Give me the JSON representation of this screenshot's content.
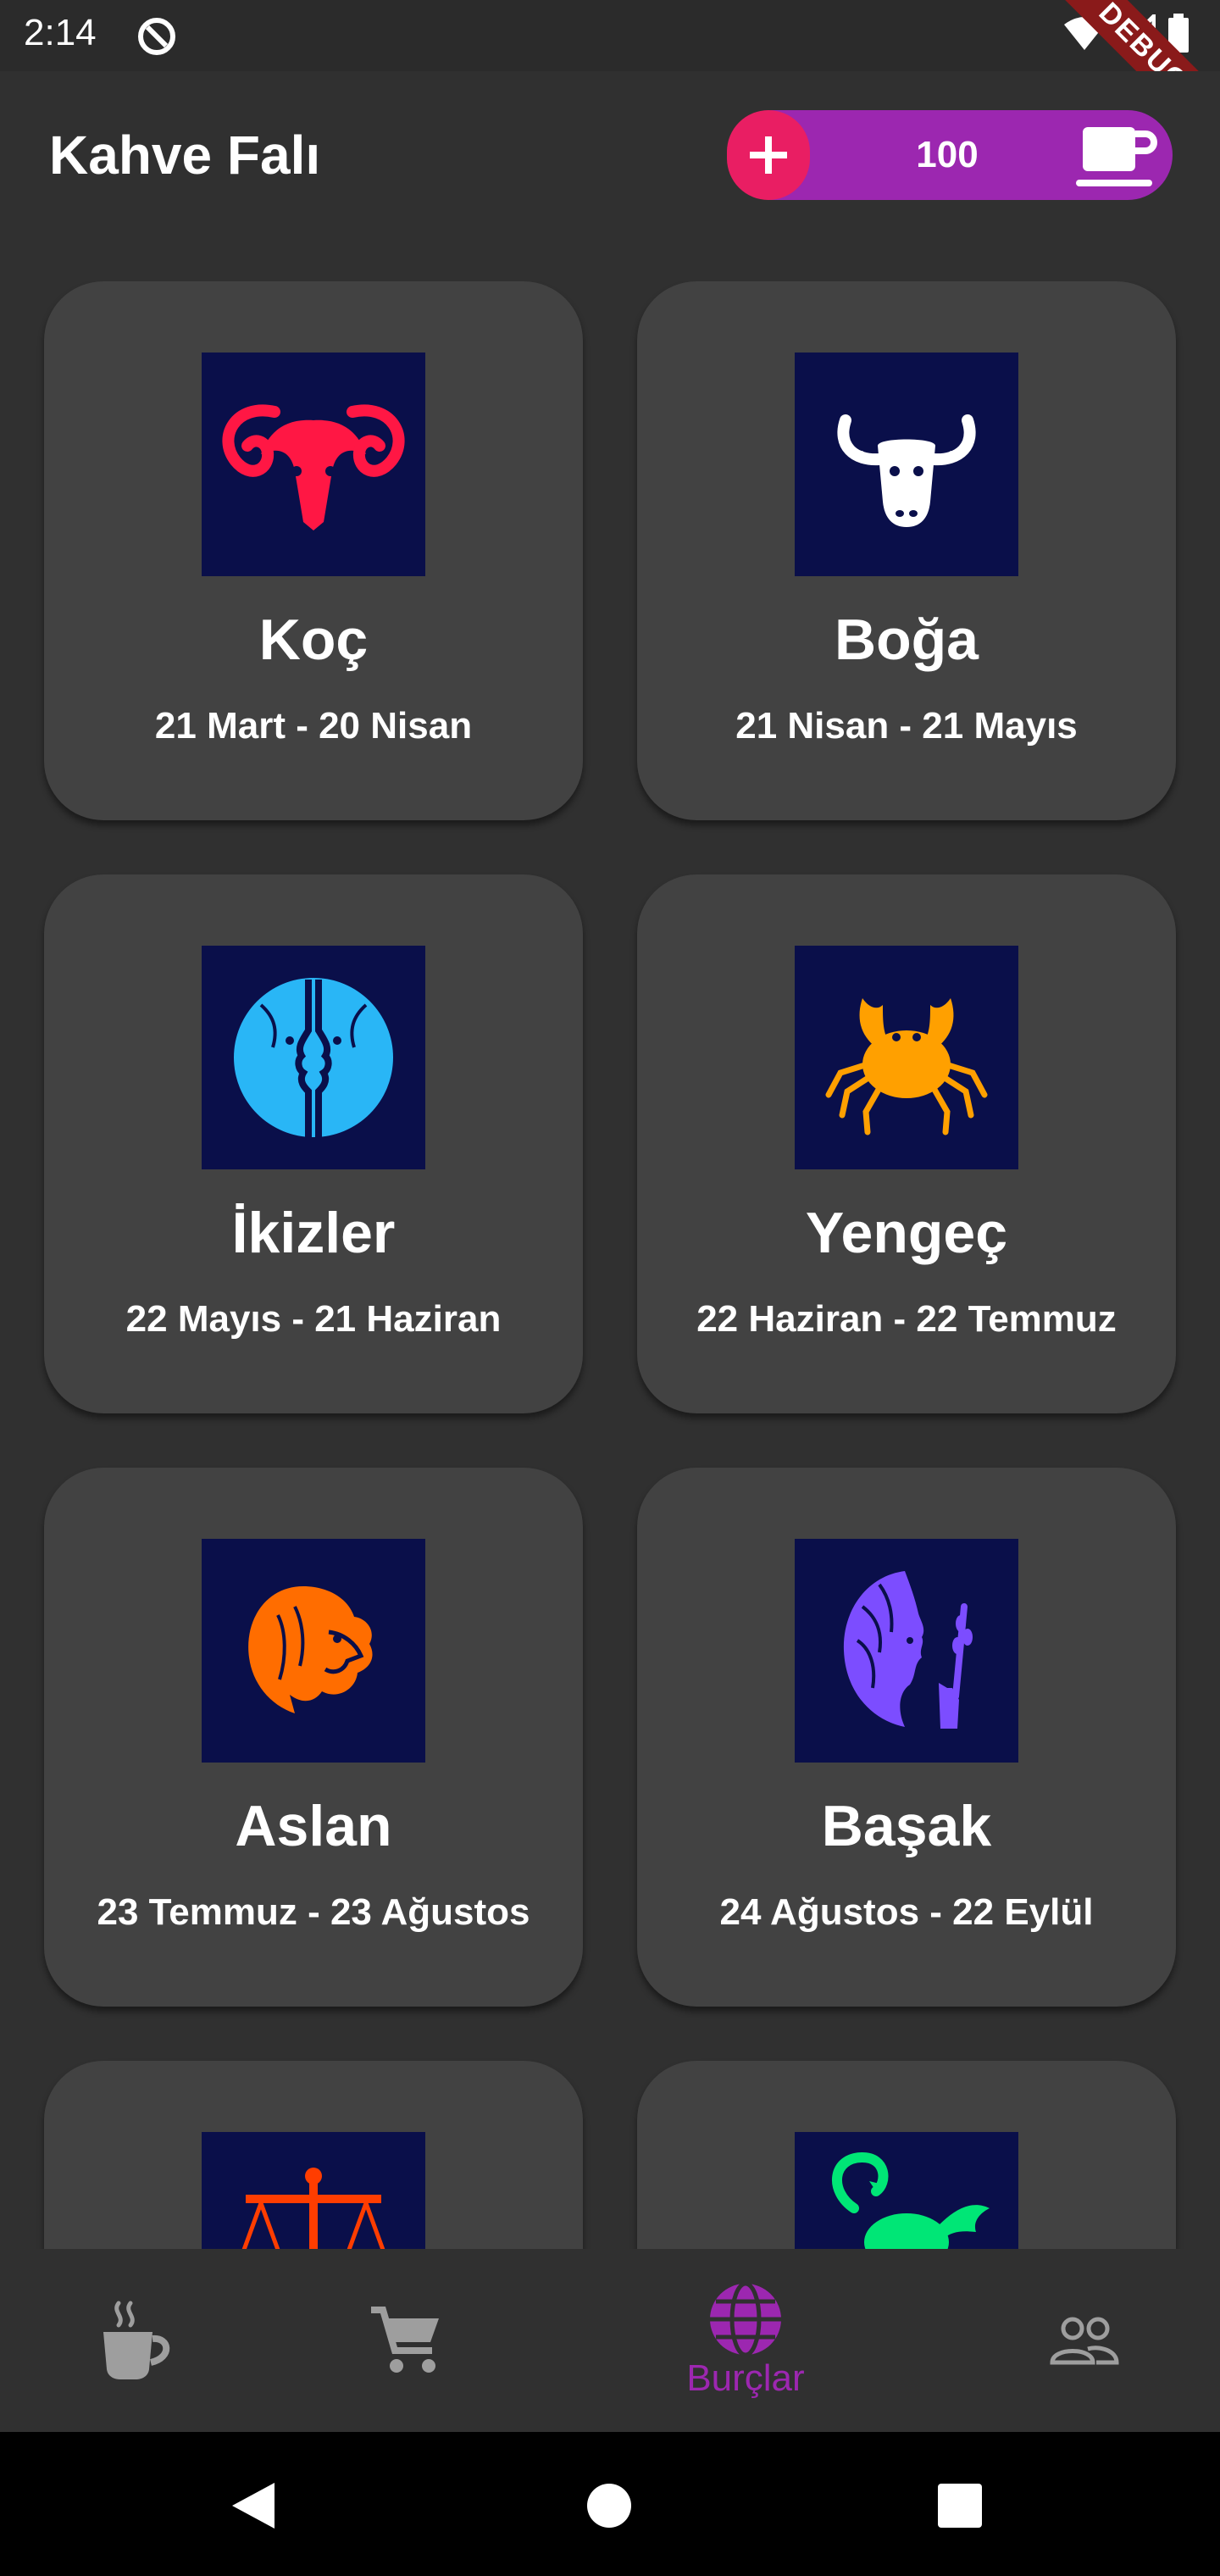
{
  "status_bar": {
    "time": "2:14",
    "debug_label": "DEBUG"
  },
  "app_bar": {
    "title": "Kahve Falı",
    "coins": "100"
  },
  "signs": [
    {
      "name": "Koç",
      "dates": "21 Mart - 20 Nisan",
      "icon": "aries-icon",
      "color": "#ff1744"
    },
    {
      "name": "Boğa",
      "dates": "21 Nisan - 21 Mayıs",
      "icon": "taurus-icon",
      "color": "#ffffff"
    },
    {
      "name": "İkizler",
      "dates": "22 Mayıs - 21 Haziran",
      "icon": "gemini-icon",
      "color": "#29b6f6"
    },
    {
      "name": "Yengeç",
      "dates": "22 Haziran - 22 Temmuz",
      "icon": "cancer-icon",
      "color": "#ffa000"
    },
    {
      "name": "Aslan",
      "dates": "23 Temmuz - 23 Ağustos",
      "icon": "leo-icon",
      "color": "#ff6d00"
    },
    {
      "name": "Başak",
      "dates": "24 Ağustos - 22 Eylül",
      "icon": "virgo-icon",
      "color": "#7c4dff"
    },
    {
      "name": "",
      "dates": "",
      "icon": "libra-icon",
      "color": "#ff3d00"
    },
    {
      "name": "",
      "dates": "",
      "icon": "scorpio-icon",
      "color": "#00e676"
    }
  ],
  "bottom_nav": {
    "items": [
      {
        "icon": "coffee-icon",
        "label": ""
      },
      {
        "icon": "cart-icon",
        "label": ""
      },
      {
        "icon": "globe-icon",
        "label": "Burçlar",
        "active": true
      },
      {
        "icon": "people-icon",
        "label": ""
      }
    ],
    "active_color": "#9c27b0",
    "inactive_color": "#9e9e9e"
  }
}
